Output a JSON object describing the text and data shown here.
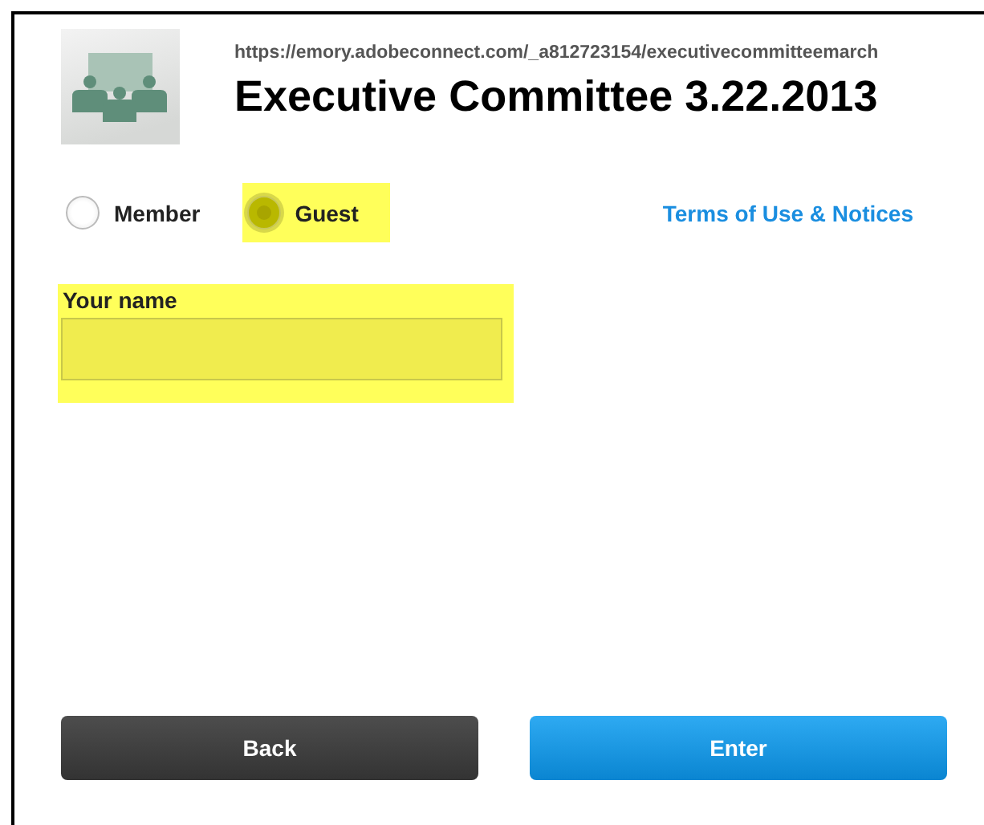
{
  "header": {
    "url": "https://emory.adobeconnect.com/_a812723154/executivecommitteemarch",
    "title": "Executive Committee 3.22.2013"
  },
  "login_types": [
    {
      "label": "Member",
      "selected": false,
      "kind": "plain"
    },
    {
      "label": "Guest",
      "selected": true,
      "kind": "highlighted"
    }
  ],
  "terms_link": "Terms of Use & Notices",
  "name_field": {
    "label": "Your name",
    "highlighted": true
  },
  "buttons": [
    {
      "label": "Back",
      "kind": "secondary"
    },
    {
      "label": "Enter",
      "kind": "primary"
    }
  ]
}
